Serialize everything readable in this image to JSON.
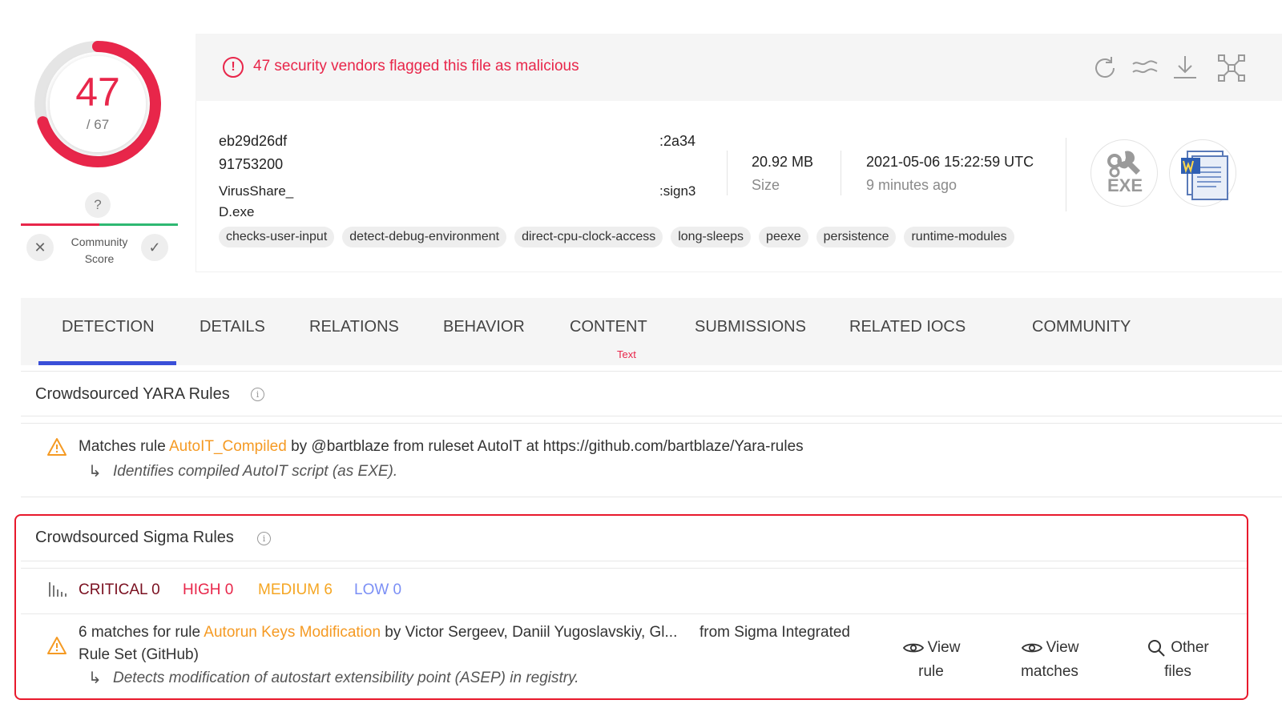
{
  "score": {
    "detections": "47",
    "total": "/ 67",
    "ratio": 0.7
  },
  "community": {
    "question": "?",
    "label_line1": "Community",
    "label_line2": "Score",
    "down": "✕",
    "up": "✓"
  },
  "alert": {
    "icon": "!",
    "text": "47 security vendors flagged this file as malicious"
  },
  "toolbar": {
    "icons": [
      "reanalyze-icon",
      "similar-icon",
      "download-icon",
      "graph-icon"
    ]
  },
  "file": {
    "hash_part1": "eb29d26df",
    "hash_part1_end": ":2a34",
    "hash_part2": "91753200",
    "name_part1": "VirusShare_",
    "name_part1_end": ":sign3",
    "name_part2": "D.exe",
    "size_value": "20.92 MB",
    "size_label": "Size",
    "date_value": "2021-05-06 15:22:59 UTC",
    "date_ago": "9 minutes ago",
    "type_badge": "EXE"
  },
  "tags": [
    "checks-user-input",
    "detect-debug-environment",
    "direct-cpu-clock-access",
    "long-sleeps",
    "peexe",
    "persistence",
    "runtime-modules"
  ],
  "tabs": {
    "detection": "DETECTION",
    "details": "DETAILS",
    "relations": "RELATIONS",
    "behavior": "BEHAVIOR",
    "content": "CONTENT",
    "content_sub": "Text",
    "submissions": "SUBMISSIONS",
    "related_iocs": "RELATED IOCS",
    "community": "COMMUNITY"
  },
  "yara": {
    "title": "Crowdsourced YARA Rules",
    "prefix": "Matches rule ",
    "rule": "AutoIT_Compiled",
    "suffix": " by @bartblaze from ruleset AutoIT at https://github.com/bartblaze/Yara-rules",
    "description": "Identifies compiled AutoIT script (as EXE)."
  },
  "sigma": {
    "title": "Crowdsourced Sigma Rules",
    "severity": {
      "critical": "CRITICAL 0",
      "high": "HIGH 0",
      "medium": "MEDIUM 6",
      "low": "LOW 0"
    },
    "match_prefix": "6 matches for rule ",
    "rule": "Autorun Keys Modification",
    "match_suffix": " by Victor Sergeev, Daniil Yugoslavskiy, Gl...",
    "source_line1": "from Sigma Integrated",
    "source_line2": "Rule Set (GitHub)",
    "description": "Detects modification of autostart extensibility point (ASEP) in registry.",
    "actions": {
      "view_rule_1": "View",
      "view_rule_2": "rule",
      "view_matches_1": "View",
      "view_matches_2": "matches",
      "other_files_1": "Other",
      "other_files_2": "files"
    }
  },
  "colors": {
    "malicious": "#e8264a",
    "accent_blue": "#3a4fd8",
    "orange": "#f59a23",
    "critical": "#7a1020",
    "high": "#e8264a",
    "medium": "#f5a623",
    "low": "#7b8ff5",
    "highlight_box": "#e8192c"
  }
}
